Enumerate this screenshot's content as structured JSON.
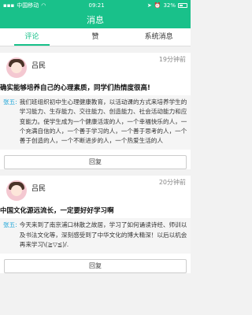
{
  "status_bar": {
    "carrier": "中国移动",
    "time": "09:21",
    "battery": "32%"
  },
  "navbar": {
    "title": "消息"
  },
  "tabs": [
    {
      "label": "评论"
    },
    {
      "label": "赞"
    },
    {
      "label": "系统消息"
    }
  ],
  "cards": [
    {
      "author": "吕民",
      "time": "19分钟前",
      "title": "确实能够培养自己的心理素质，同学们热情度很高!",
      "commenter": "张五:",
      "comment": "我们班组织初中生心理健康教育，以活动课的方式来培养学生的学习能力、生存能力、交往能力、创造能力、社会活动能力和应变能力。使学生成为一个健康活泼的人，一个幸福快乐的人，一个充满自信的人，一个善于学习的人，一个善于思考的人，一个善于创造的人，一个不断进步的人，一个热爱生活的人",
      "reply": "回复"
    },
    {
      "author": "吕民",
      "time": "20分钟前",
      "title": "中国文化源远流长，一定要好好学习啊",
      "commenter": "张五:",
      "comment": "今天来到了南京浦口林散之故居，学习了如何诵读诗经、师训以及书法文化等，深刻感受到了中华文化的博大精深！以后以机会再来学习\\(≧▽≦)/.",
      "reply": "回复"
    }
  ]
}
